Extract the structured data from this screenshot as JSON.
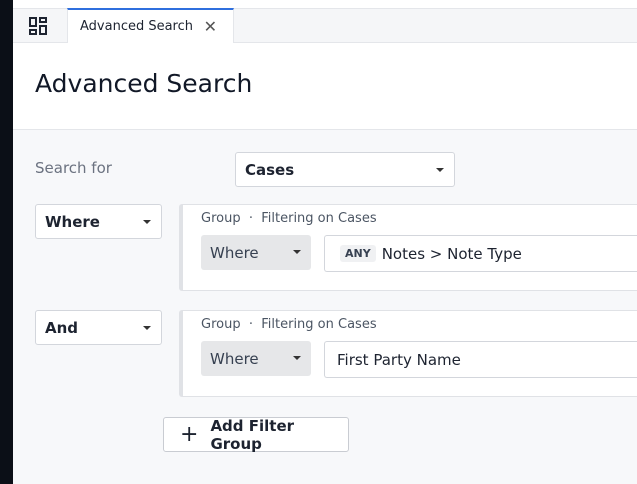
{
  "tabs": [
    {
      "label": "Advanced Search",
      "active": true
    }
  ],
  "page_title": "Advanced Search",
  "search_for": {
    "label": "Search for",
    "value": "Cases"
  },
  "groups": [
    {
      "connector": "Where",
      "header_group": "Group",
      "header_sep": "·",
      "header_filter": "Filtering on Cases",
      "operator": "Where",
      "badge": "ANY",
      "field": "Notes > Note Type"
    },
    {
      "connector": "And",
      "header_group": "Group",
      "header_sep": "·",
      "header_filter": "Filtering on Cases",
      "operator": "Where",
      "field": "First Party Name"
    }
  ],
  "add_filter_group": "Add Filter Group",
  "colors": {
    "accent": "#2f6fde"
  }
}
